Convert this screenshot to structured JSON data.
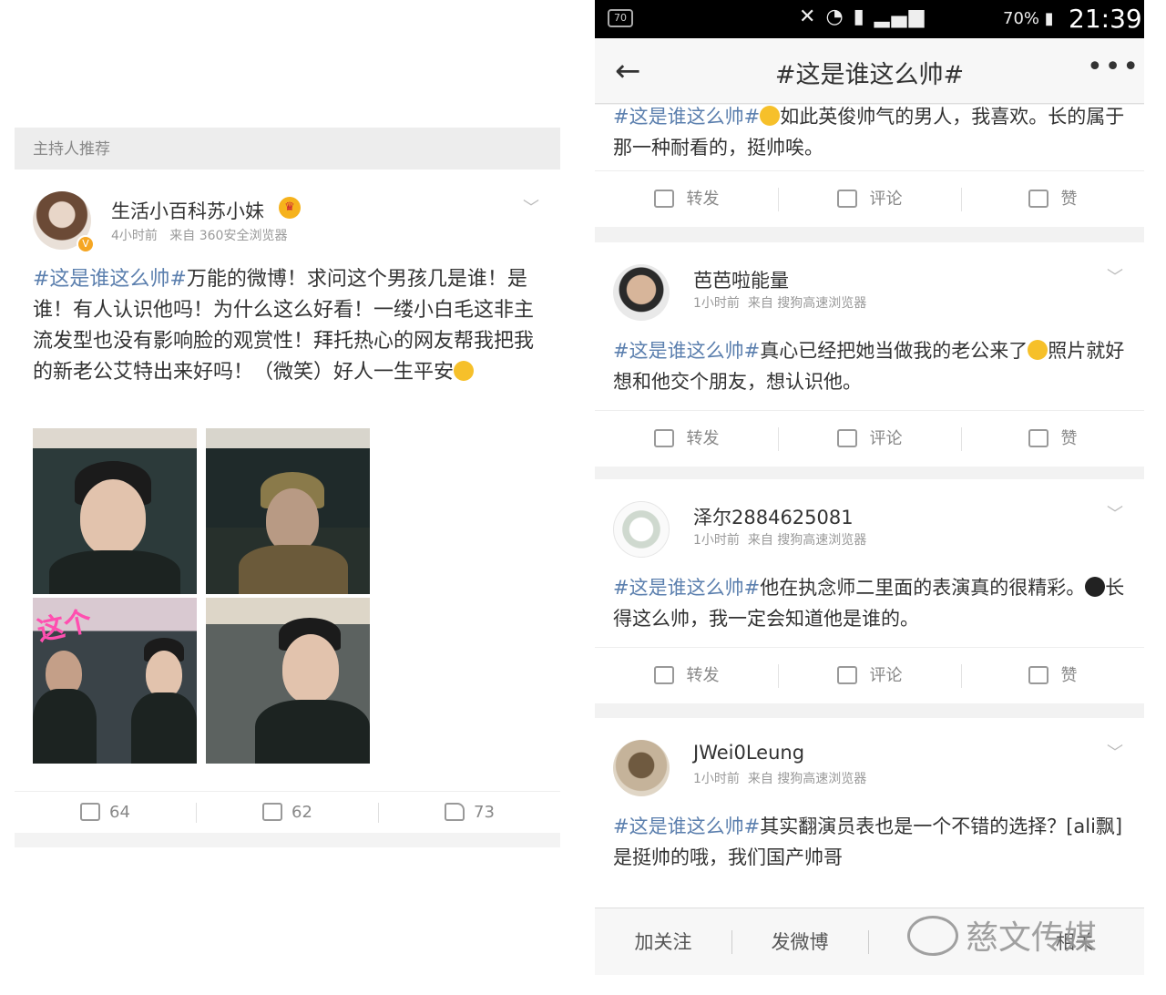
{
  "left": {
    "section_label": "主持人推荐",
    "post": {
      "username": "生活小百科苏小妹",
      "time": "4小时前",
      "source": "来自 360安全浏览器",
      "topic": "#这是谁这么帅#",
      "text": "万能的微博！求问这个男孩几是谁！是谁！有人认识他吗！为什么这么好看！一缕小白毛这非主流发型也没有影响脸的观赏性！拜托热心的网友帮我把我的新老公艾特出来好吗！（微笑）好人一生平安",
      "photo_overlay_text": "这个",
      "repost_count": "64",
      "comment_count": "62",
      "like_count": "73"
    }
  },
  "phone": {
    "status_time": "21:39",
    "battery": "70%",
    "status_box": "70",
    "title": "#这是谁这么帅#",
    "back_icon": "←",
    "more_icon": "•••",
    "actions": {
      "repost": "转发",
      "comment": "评论",
      "like": "赞"
    },
    "posts": [
      {
        "topic": "#这是谁这么帅#",
        "text": "如此英俊帅气的男人，我喜欢。长的属于那一种耐看的，挺帅唉。"
      },
      {
        "username": "芭芭啦能量",
        "time": "1小时前",
        "source": "来自 搜狗高速浏览器",
        "topic": "#这是谁这么帅#",
        "text": "真心已经把她当做我的老公来了",
        "text2": "照片就好想和他交个朋友，想认识他。"
      },
      {
        "username": "泽尔2884625081",
        "time": "1小时前",
        "source": "来自 搜狗高速浏览器",
        "topic": "#这是谁这么帅#",
        "text": "他在执念师二里面的表演真的很精彩。",
        "text2": "长得这么帅，我一定会知道他是谁的。"
      },
      {
        "username": "JWei0Leung",
        "time": "1小时前",
        "source": "来自 搜狗高速浏览器",
        "topic": "#这是谁这么帅#",
        "text": "其实翻演员表也是一个不错的选择？[ali飘]是挺帅的哦，我们国产帅哥"
      }
    ],
    "bottom": {
      "follow": "加关注",
      "post": "发微博",
      "other": "相关"
    }
  },
  "watermark": "慈文传媒"
}
